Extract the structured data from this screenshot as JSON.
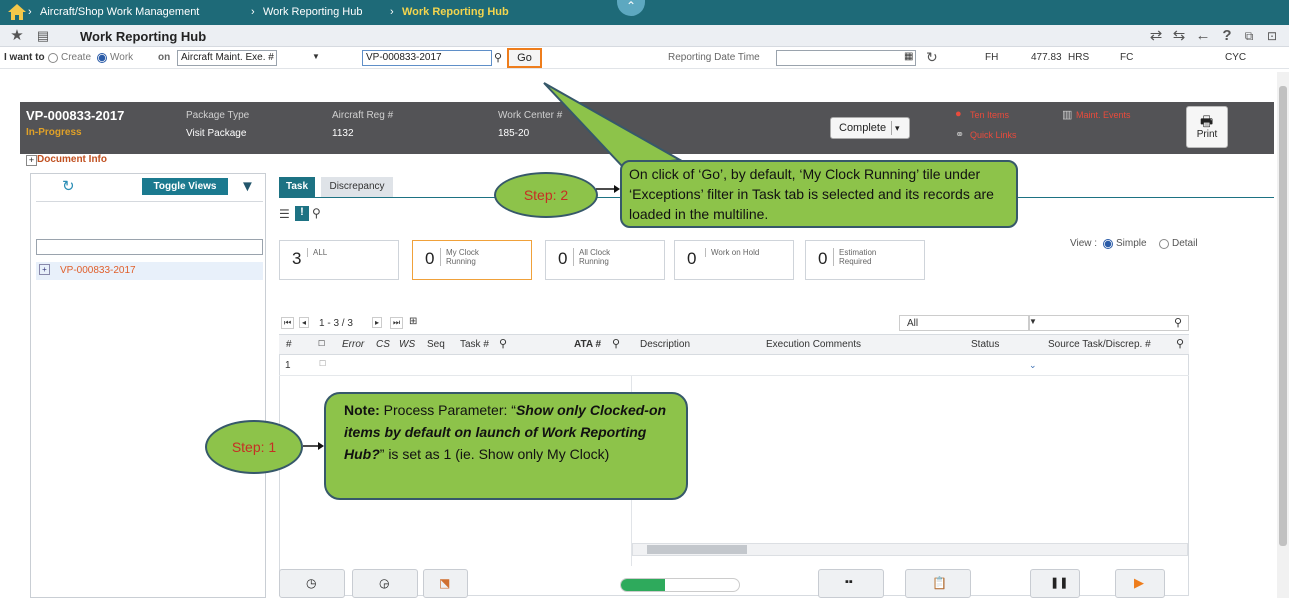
{
  "breadcrumb": {
    "items": [
      "Aircraft/Shop Work Management",
      "Work Reporting Hub"
    ],
    "current": "Work Reporting Hub"
  },
  "titlebar": {
    "title": "Work Reporting Hub"
  },
  "iwant": {
    "label": "I want to",
    "create": "Create",
    "work": "Work",
    "on": "on",
    "on_select": "Aircraft Maint. Exe. #",
    "doc_value": "VP-000833-2017",
    "go_label": "Go",
    "reporting_label": "Reporting Date Time",
    "fh_label": "FH",
    "fh_value": "477.83",
    "hrs": "HRS",
    "fc_label": "FC",
    "cyc": "CYC"
  },
  "band": {
    "doc": "VP-000833-2017",
    "status": "In-Progress",
    "pkg_type_label": "Package Type",
    "pkg_type": "Visit Package",
    "reg_label": "Aircraft Reg #",
    "reg": "1132",
    "wc_label": "Work Center #",
    "wc": "185-20",
    "complete": "Complete",
    "ten_items": "Ten Items",
    "quick_links": "Quick Links",
    "maint_events": "Maint. Events",
    "print": "Print"
  },
  "docinfo": {
    "label": "Document Info"
  },
  "left": {
    "toggle": "Toggle Views",
    "node": "VP-000833-2017"
  },
  "tabs": {
    "task": "Task",
    "discrepancy": "Discrepancy"
  },
  "tiles": [
    {
      "count": "3",
      "label": "ALL"
    },
    {
      "count": "0",
      "label": "My Clock Running"
    },
    {
      "count": "0",
      "label": "All Clock Running"
    },
    {
      "count": "0",
      "label": "Work on Hold"
    },
    {
      "count": "0",
      "label": "Estimation Required"
    }
  ],
  "view": {
    "label": "View :",
    "simple": "Simple",
    "detail": "Detail"
  },
  "grid": {
    "pager": "1 - 3 / 3",
    "filter": "All",
    "headers": [
      "#",
      "Error",
      "CS",
      "WS",
      "Seq",
      "Task #",
      "ATA #",
      "Description",
      "Execution Comments",
      "Status",
      "Source Task/Discrep. #"
    ],
    "row1_index": "1"
  },
  "callouts": {
    "step2_label": "Step: 2",
    "step2_text": "On click of ‘Go’, by default, ‘My Clock Running’ tile under ‘Exceptions’ filter in Task tab is selected and its records are loaded in the multiline.",
    "step1_label": "Step: 1",
    "note_label": "Note:",
    "note_text1": " Process Parameter: “",
    "note_italic": "Show only Clocked-on items by default on launch of Work Reporting Hub?",
    "note_text2": "” is set as 1 (ie. Show only My Clock)"
  },
  "colors": {
    "accent": "#1d7283",
    "callout": "#8dc34a",
    "highlight": "#ee7d1c"
  }
}
